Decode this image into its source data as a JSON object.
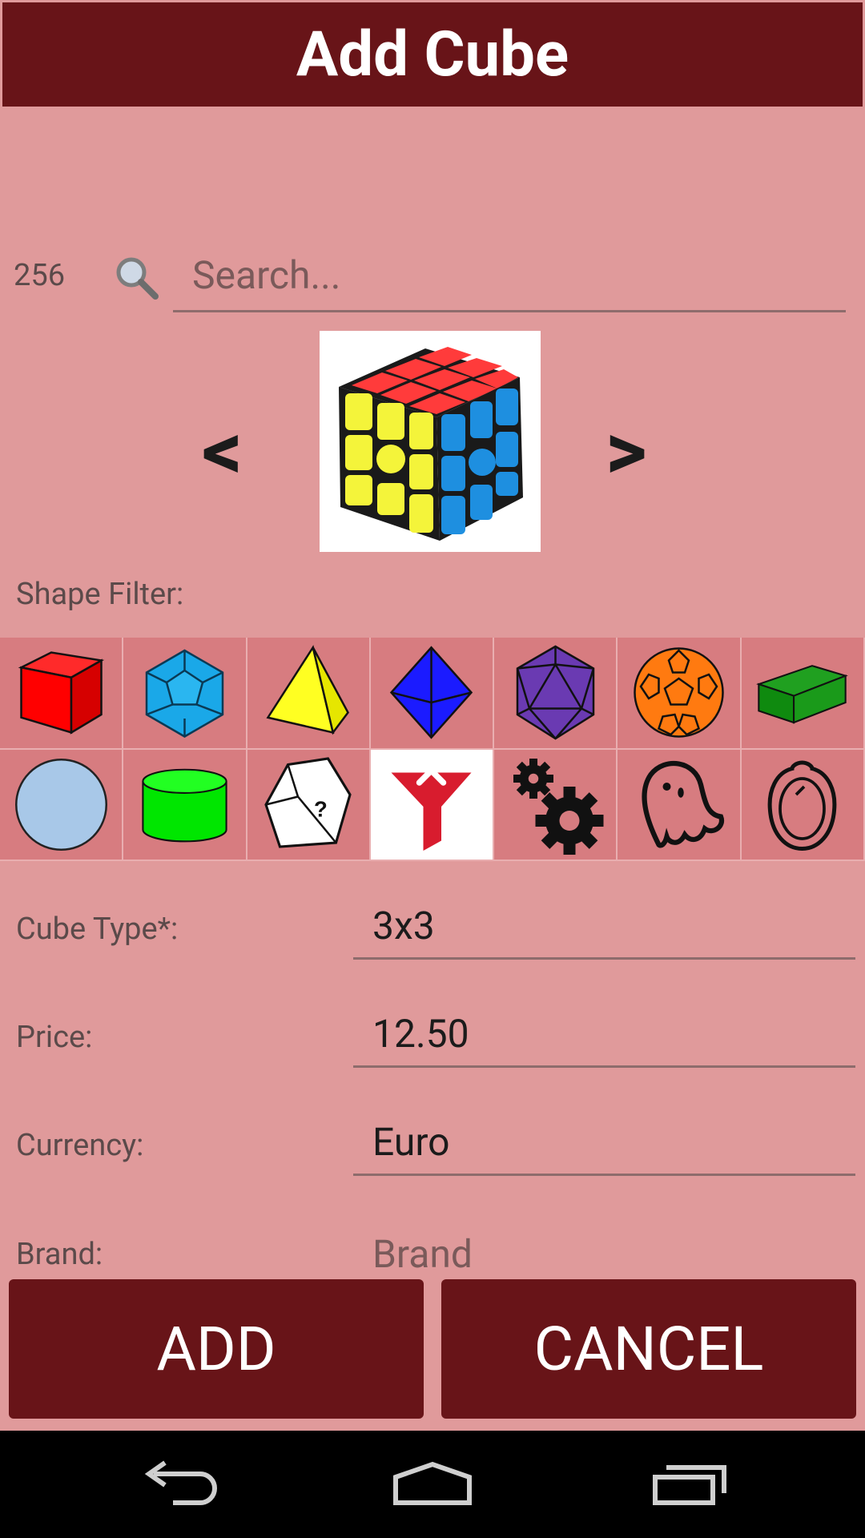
{
  "header": {
    "title": "Add Cube"
  },
  "search": {
    "count": "256",
    "placeholder": "Search..."
  },
  "carousel": {
    "prev_label": "<",
    "next_label": ">",
    "image": "3x3-cube-image"
  },
  "shape_filter": {
    "label": "Shape Filter:",
    "shapes": [
      "cube-icon",
      "dodecahedron-icon",
      "tetrahedron-icon",
      "octahedron-icon",
      "icosahedron-icon",
      "ball-icon",
      "cuboid-icon",
      "sphere-icon",
      "cylinder-icon",
      "irregular-shape-icon",
      "clear-filter-icon",
      "gears-icon",
      "ghost-icon",
      "mirror-icon"
    ],
    "selected": "clear-filter-icon"
  },
  "form": {
    "cube_type": {
      "label": "Cube Type*:",
      "value": "3x3"
    },
    "price": {
      "label": "Price:",
      "value": "12.50"
    },
    "currency": {
      "label": "Currency:",
      "value": "Euro"
    },
    "brand": {
      "label": "Brand:",
      "placeholder": "Brand"
    }
  },
  "buttons": {
    "add": "ADD",
    "cancel": "CANCEL"
  },
  "colors": {
    "primary": "#681418",
    "background": "#e09a9b",
    "grid": "#d77c80"
  }
}
